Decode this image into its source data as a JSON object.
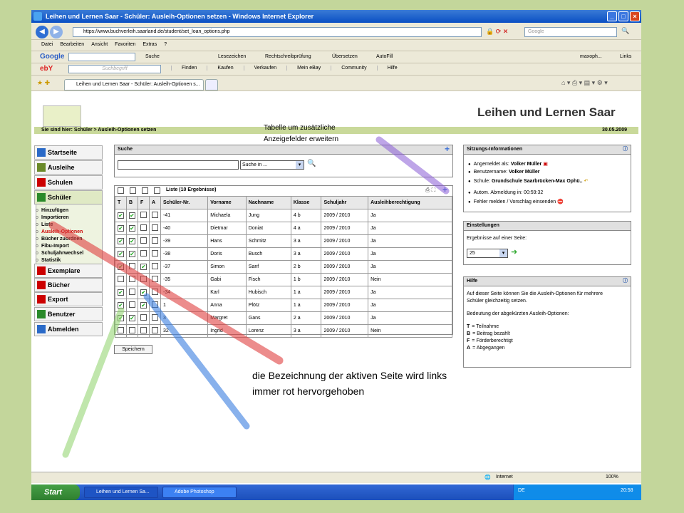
{
  "window": {
    "title": "Leihen und Lernen Saar - Schüler: Ausleih-Optionen setzen - Windows Internet Explorer",
    "url": "https://www.buchverleih.saarland.de/student/set_loan_options.php",
    "search_placeholder": "Google"
  },
  "menu": [
    "Datei",
    "Bearbeiten",
    "Ansicht",
    "Favoriten",
    "Extras",
    "?"
  ],
  "google_toolbar": {
    "brand": "Google",
    "search": "Suche",
    "bookmarks": "Lesezeichen",
    "spell": "Rechtschreibprüfung",
    "translate": "Übersetzen",
    "autofill": "AutoFill",
    "user": "maxoph...",
    "links": "Links"
  },
  "ebay_toolbar": {
    "brand": "ebY",
    "placeholder": "Suchbegriff",
    "items": [
      "Finden",
      "Kaufen",
      "Verkaufen",
      "Mein eBay",
      "Community",
      "Hilfe"
    ]
  },
  "tab": {
    "label": "Leihen und Lernen Saar - Schüler: Ausleih-Optionen s..."
  },
  "site": {
    "title": "Leihen und Lernen Saar",
    "breadcrumb": "Sie sind hier: Schüler > Ausleih-Optionen setzen",
    "date": "30.05.2009"
  },
  "nav": {
    "top": [
      "Startseite",
      "Ausleihe",
      "Schulen",
      "Schüler"
    ],
    "sub": [
      "Hinzufügen",
      "Importieren",
      "Liste",
      "Ausleih-Optionen",
      "Bücher zuordnen",
      "Fibu-Import",
      "Schuljahrwechsel",
      "Statistik"
    ],
    "bottom": [
      "Exemplare",
      "Bücher",
      "Export",
      "Benutzer",
      "Abmelden"
    ]
  },
  "search": {
    "title": "Suche",
    "select": "Suche in ..."
  },
  "list": {
    "title": "Liste (10 Ergebnisse)",
    "headers": [
      "T",
      "B",
      "F",
      "A",
      "Schüler-Nr.",
      "Vorname",
      "Nachname",
      "Klasse",
      "Schuljahr",
      "Ausleihberechtigung"
    ],
    "rows": [
      {
        "t": true,
        "b": true,
        "f": false,
        "a": false,
        "nr": "-41",
        "vorname": "Michaela",
        "nachname": "Jung",
        "klasse": "4 b",
        "jahr": "2009 / 2010",
        "ber": "Ja"
      },
      {
        "t": true,
        "b": true,
        "f": false,
        "a": false,
        "nr": "-40",
        "vorname": "Dietmar",
        "nachname": "Doniat",
        "klasse": "4 a",
        "jahr": "2009 / 2010",
        "ber": "Ja"
      },
      {
        "t": true,
        "b": true,
        "f": false,
        "a": false,
        "nr": "-39",
        "vorname": "Hans",
        "nachname": "Schmitz",
        "klasse": "3 a",
        "jahr": "2009 / 2010",
        "ber": "Ja"
      },
      {
        "t": true,
        "b": true,
        "f": false,
        "a": false,
        "nr": "-38",
        "vorname": "Doris",
        "nachname": "Busch",
        "klasse": "3 a",
        "jahr": "2009 / 2010",
        "ber": "Ja"
      },
      {
        "t": true,
        "b": false,
        "f": true,
        "a": false,
        "nr": "-37",
        "vorname": "Simon",
        "nachname": "Sanf",
        "klasse": "2 b",
        "jahr": "2009 / 2010",
        "ber": "Ja"
      },
      {
        "t": false,
        "b": false,
        "f": false,
        "a": false,
        "nr": "-35",
        "vorname": "Gabi",
        "nachname": "Fisch",
        "klasse": "1 b",
        "jahr": "2009 / 2010",
        "ber": "Nein"
      },
      {
        "t": true,
        "b": false,
        "f": true,
        "a": false,
        "nr": "-34",
        "vorname": "Karl",
        "nachname": "Hubisch",
        "klasse": "1 a",
        "jahr": "2009 / 2010",
        "ber": "Ja"
      },
      {
        "t": true,
        "b": false,
        "f": true,
        "a": false,
        "nr": "1",
        "vorname": "Anna",
        "nachname": "Plötz",
        "klasse": "1 a",
        "jahr": "2009 / 2010",
        "ber": "Ja"
      },
      {
        "t": true,
        "b": true,
        "f": false,
        "a": false,
        "nr": "3",
        "vorname": "Margret",
        "nachname": "Gans",
        "klasse": "2 a",
        "jahr": "2009 / 2010",
        "ber": "Ja"
      },
      {
        "t": false,
        "b": false,
        "f": false,
        "a": false,
        "nr": "32",
        "vorname": "Ingrid",
        "nachname": "Lorenz",
        "klasse": "3 a",
        "jahr": "2009 / 2010",
        "ber": "Nein"
      }
    ],
    "save": "Speichern"
  },
  "session": {
    "title": "Sitzungs-Informationen",
    "login_label": "Angemeldet als:",
    "login": "Volker Müller",
    "user_label": "Benutzername:",
    "user": "Volker Müller",
    "school_label": "Schule:",
    "school": "Grundschule Saarbrücken-Max Ophü..",
    "logout": "Autom. Abmeldung in: 00:59:32",
    "report": "Fehler melden / Vorschlag einsenden"
  },
  "settings": {
    "title": "Einstellungen",
    "label": "Ergebnisse auf einer Seite:",
    "value": "25"
  },
  "help": {
    "title": "Hilfe",
    "text1": "Auf dieser Seite können Sie die Ausleih-Optionen für mehrere",
    "text2": "Schüler gleichzeitig setzen.",
    "text3": "Bedeutung der abgekürzten Ausleih-Optionen:",
    "legend": [
      {
        "k": "T",
        "v": "= Teilnahme"
      },
      {
        "k": "B",
        "v": "= Beitrag bezahlt"
      },
      {
        "k": "F",
        "v": "= Förderberechtigt"
      },
      {
        "k": "A",
        "v": "= Abgegangen"
      }
    ]
  },
  "callouts": {
    "top1": "Tabelle um zusätzliche",
    "top2": "Anzeigefelder erweitern",
    "bottom1": "die Bezeichnung der aktiven Seite wird links",
    "bottom2": "immer rot hervorgehoben"
  },
  "status": {
    "zone": "Internet",
    "zoom": "100%"
  },
  "taskbar": {
    "start": "Start",
    "tasks": [
      "Leihen und Lernen Sa...",
      "Adobe Photoshop"
    ],
    "lang": "DE",
    "time": "20:58"
  },
  "colors": {
    "arrow_purple": "#8a5cd6",
    "arrow_red": "#e04040",
    "arrow_blue": "#3a7ee0",
    "arrow_green": "#8ed36a"
  }
}
